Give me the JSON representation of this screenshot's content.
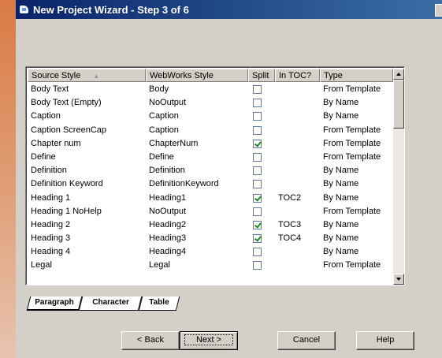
{
  "window": {
    "title": "New Project Wizard - Step 3 of 6",
    "icon": "wizard-window-icon"
  },
  "table": {
    "columns": [
      "Source Style",
      "WebWorks Style",
      "Split",
      "In TOC?",
      "Type"
    ],
    "sorted_column": "Source Style",
    "rows": [
      {
        "source": "Body Text",
        "webworks": "Body",
        "split": false,
        "toc": "",
        "type": "From Template"
      },
      {
        "source": "Body Text (Empty)",
        "webworks": "NoOutput",
        "split": false,
        "toc": "",
        "type": "By Name"
      },
      {
        "source": "Caption",
        "webworks": "Caption",
        "split": false,
        "toc": "",
        "type": "By Name"
      },
      {
        "source": "Caption ScreenCap",
        "webworks": "Caption",
        "split": false,
        "toc": "",
        "type": "From Template"
      },
      {
        "source": "Chapter num",
        "webworks": "ChapterNum",
        "split": true,
        "toc": "",
        "type": "From Template"
      },
      {
        "source": "Define",
        "webworks": "Define",
        "split": false,
        "toc": "",
        "type": "From Template"
      },
      {
        "source": "Definition",
        "webworks": "Definition",
        "split": false,
        "toc": "",
        "type": "By Name"
      },
      {
        "source": "Definition Keyword",
        "webworks": "DefinitionKeyword",
        "split": false,
        "toc": "",
        "type": "By Name"
      },
      {
        "source": "Heading 1",
        "webworks": "Heading1",
        "split": true,
        "toc": "TOC2",
        "type": "By Name"
      },
      {
        "source": "Heading 1 NoHelp",
        "webworks": "NoOutput",
        "split": false,
        "toc": "",
        "type": "From Template"
      },
      {
        "source": "Heading 2",
        "webworks": "Heading2",
        "split": true,
        "toc": "TOC3",
        "type": "By Name"
      },
      {
        "source": "Heading 3",
        "webworks": "Heading3",
        "split": true,
        "toc": "TOC4",
        "type": "By Name"
      },
      {
        "source": "Heading 4",
        "webworks": "Heading4",
        "split": false,
        "toc": "",
        "type": "By Name"
      },
      {
        "source": "Legal",
        "webworks": "Legal",
        "split": false,
        "toc": "",
        "type": "From Template"
      }
    ]
  },
  "tabs": [
    {
      "label": "Paragraph",
      "active": true
    },
    {
      "label": "Character",
      "active": false
    },
    {
      "label": "Table",
      "active": false
    }
  ],
  "buttons": {
    "back": "< Back",
    "next": "Next >",
    "cancel": "Cancel",
    "help": "Help"
  },
  "colors": {
    "titlebar_start": "#0a246a",
    "titlebar_end": "#3a6ea5",
    "check": "#1d8a1d"
  }
}
